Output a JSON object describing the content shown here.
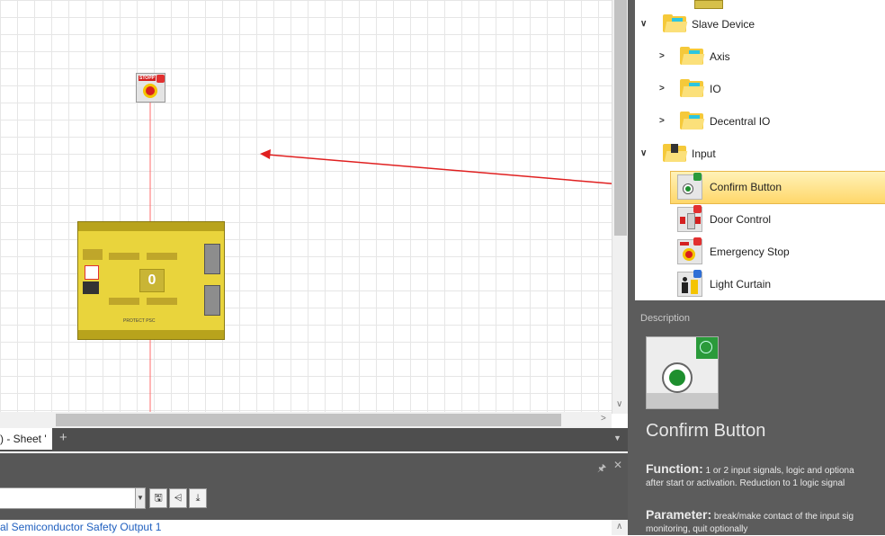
{
  "canvas": {
    "emergency_stop_label": "STOPP",
    "plc_display_value": "0",
    "plc_model_label": "PROTECT PSC"
  },
  "tabs": {
    "sheet_label": ") - Sheet '",
    "add_label": "+"
  },
  "output_panel": {
    "text": "al Semiconductor Safety Output 1"
  },
  "tree": {
    "items": [
      {
        "label": "Slave Device",
        "icon": "folder-open-icon"
      },
      {
        "label": "Axis",
        "icon": "folder-icon"
      },
      {
        "label": "IO",
        "icon": "folder-icon"
      },
      {
        "label": "Decentral IO",
        "icon": "folder-icon"
      },
      {
        "label": "Input",
        "icon": "folder-open-icon"
      },
      {
        "label": "Confirm Button",
        "icon": "confirm-button-icon",
        "selected": true
      },
      {
        "label": "Door Control",
        "icon": "door-control-icon"
      },
      {
        "label": "Emergency Stop",
        "icon": "emergency-stop-icon"
      },
      {
        "label": "Light Curtain",
        "icon": "light-curtain-icon"
      }
    ]
  },
  "description": {
    "label": "Description",
    "title": "Confirm Button",
    "function_label": "Function:",
    "function_text_1": " 1 or 2 input signals, logic and optiona",
    "function_text_2": "after start or activation. Reduction to 1 logic signal",
    "parameter_label": "Parameter:",
    "parameter_text_1": " break/make contact of the input sig",
    "parameter_text_2": "monitoring, quit optionally"
  },
  "colors": {
    "connection_line": "#ff6b6b",
    "drag_arrow": "#e02020",
    "selection": "#ffd76a",
    "link_text": "#1f5fbf"
  }
}
